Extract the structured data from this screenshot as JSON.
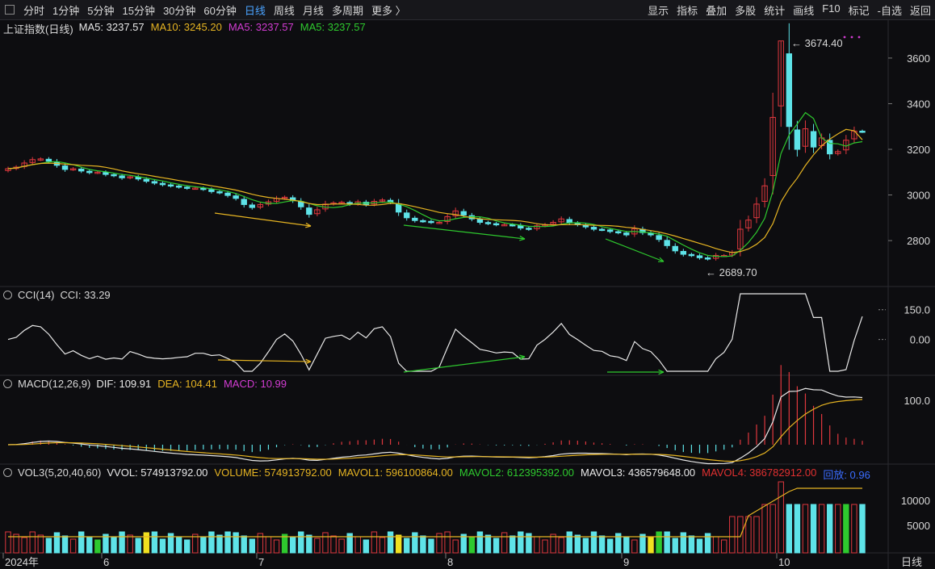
{
  "toolbar": {
    "left": [
      "分时",
      "1分钟",
      "5分钟",
      "15分钟",
      "30分钟",
      "60分钟",
      "日线",
      "周线",
      "月线",
      "多周期",
      "更多 〉"
    ],
    "active": "日线",
    "right": [
      "显示",
      "指标",
      "叠加",
      "多股",
      "统计",
      "画线",
      "F10",
      "标记",
      "-自选",
      "返回"
    ]
  },
  "main_pane": {
    "title": "上证指数(日线)",
    "indicators": [
      {
        "label": "MA5: 3237.57",
        "color": "#e8e8e8"
      },
      {
        "label": "MA10: 3245.20",
        "color": "#e6b422"
      },
      {
        "label": "MA5: 3237.57",
        "color": "#d23cd2"
      },
      {
        "label": "MA5: 3237.57",
        "color": "#2ec92e"
      }
    ],
    "high_label": "3674.40",
    "low_label": "2689.70",
    "y_ticks": [
      "3600",
      "3400",
      "3200",
      "3000",
      "2800"
    ]
  },
  "cci_pane": {
    "title": "CCI(14)",
    "value_label": "CCI: 33.29",
    "y_ticks": [
      "150.0",
      "0.00"
    ]
  },
  "macd_pane": {
    "title": "MACD(12,26,9)",
    "values": [
      {
        "label": "DIF: 109.91",
        "color": "#e8e8e8"
      },
      {
        "label": "DEA: 104.41",
        "color": "#e6b422"
      },
      {
        "label": "MACD: 10.99",
        "color": "#d23cd2"
      }
    ],
    "y_ticks": [
      "100.0"
    ]
  },
  "vol_pane": {
    "title": "VOL3(5,20,40,60)",
    "values": [
      {
        "label": "VVOL: 574913792.00",
        "color": "#e8e8e8"
      },
      {
        "label": "VOLUME: 574913792.00",
        "color": "#e6b422"
      },
      {
        "label": "MAVOL1: 596100864.00",
        "color": "#e6b422"
      },
      {
        "label": "MAVOL2: 612395392.00",
        "color": "#2ec92e"
      },
      {
        "label": "MAVOL3: 436579648.00",
        "color": "#e8e8e8"
      },
      {
        "label": "MAVOL4: 386782912.00",
        "color": "#e03030"
      },
      {
        "label": "回放: 0.96",
        "color": "#3a6cff"
      }
    ],
    "y_ticks": [
      "10000",
      "5000"
    ]
  },
  "x_axis": {
    "labels": [
      "2024年",
      "6",
      "7",
      "8",
      "9",
      "10"
    ],
    "period_label": "日线"
  },
  "chart_data": {
    "type": "candlestick",
    "close": [
      3115,
      3122,
      3140,
      3155,
      3158,
      3148,
      3130,
      3112,
      3115,
      3105,
      3098,
      3100,
      3090,
      3085,
      3075,
      3080,
      3070,
      3060,
      3052,
      3045,
      3040,
      3035,
      3030,
      3030,
      3025,
      3015,
      3010,
      2998,
      2985,
      2958,
      2945,
      2958,
      2970,
      2985,
      2990,
      2975,
      2948,
      2915,
      2935,
      2960,
      2965,
      2968,
      2960,
      2970,
      2958,
      2972,
      2978,
      2968,
      2925,
      2900,
      2888,
      2885,
      2880,
      2880,
      2905,
      2930,
      2912,
      2895,
      2880,
      2875,
      2870,
      2870,
      2868,
      2855,
      2850,
      2865,
      2870,
      2880,
      2895,
      2878,
      2870,
      2860,
      2850,
      2848,
      2840,
      2835,
      2825,
      2852,
      2835,
      2825,
      2805,
      2778,
      2755,
      2740,
      2735,
      2725,
      2720,
      2735,
      2735,
      2748,
      2850,
      2890,
      2960,
      3040,
      3340,
      3675,
      3300,
      3200,
      3290,
      3210,
      3250,
      3180,
      3190,
      3240,
      3280,
      3278
    ],
    "high_value": 3674.4,
    "low_value": 2689.7,
    "ma5_last": 3237.57,
    "ma10_last": 3245.2,
    "cci_last": 33.29,
    "dif_last": 109.91,
    "dea_last": 104.41,
    "macd_last": 10.99,
    "y_range": [
      2620,
      3720
    ]
  }
}
